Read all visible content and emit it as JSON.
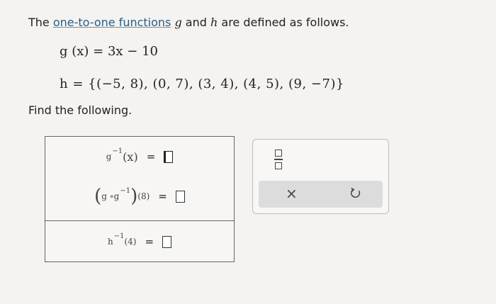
{
  "prompt": {
    "prefix": "The ",
    "link": "one-to-one functions",
    "var_g": "g",
    "and": " and ",
    "var_h": "h",
    "suffix": " are defined as follows."
  },
  "equations": {
    "g_def": "g (x) = 3x − 10",
    "h_def": "h = {(−5,  8),  (0,  7),  (3,  4),  (4,  5),  (9,  −7)}"
  },
  "find_label": "Find the following.",
  "answers": {
    "row1": {
      "fn": "g",
      "sup": "−1",
      "arg": "(x)",
      "eq": "="
    },
    "row2": {
      "lparen": "(",
      "inner": "g ∘g",
      "sup": "−1",
      "rparen": ")",
      "arg": "(8)",
      "eq": "="
    },
    "row3": {
      "fn": "h",
      "sup": "−1",
      "arg": "(4)",
      "eq": "="
    }
  },
  "tools": {
    "fraction_icon": "fraction-icon",
    "clear_label": "×",
    "undo_icon": "undo-icon"
  }
}
